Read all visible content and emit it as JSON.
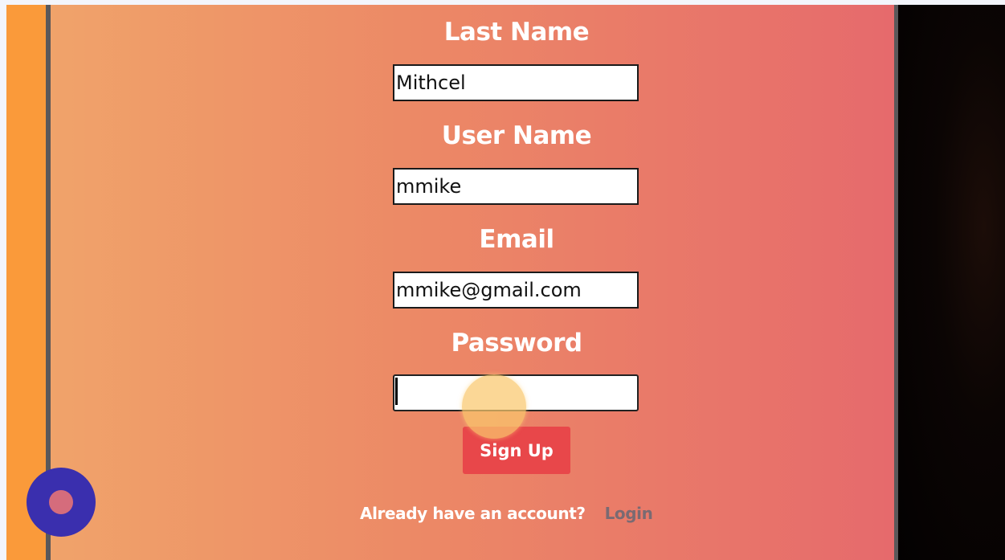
{
  "form": {
    "last_name": {
      "label": "Last Name",
      "value": "Mithcel"
    },
    "user_name": {
      "label": "User Name",
      "value": "mmike"
    },
    "email": {
      "label": "Email",
      "value": "mmike@gmail.com"
    },
    "password": {
      "label": "Password",
      "value": ""
    },
    "submit_label": "Sign Up"
  },
  "footer": {
    "prompt": "Already have an account?",
    "login_link": "Login"
  },
  "colors": {
    "side_strip": "#fa9a3a",
    "gradient_start": "#f0a36a",
    "gradient_end": "#e66a6c",
    "button": "#e8474a",
    "fab": "#3a2fae",
    "fab_dot": "#d56c7c"
  },
  "icons": {
    "fab": "record-icon",
    "pointer": "click-indicator-icon"
  }
}
